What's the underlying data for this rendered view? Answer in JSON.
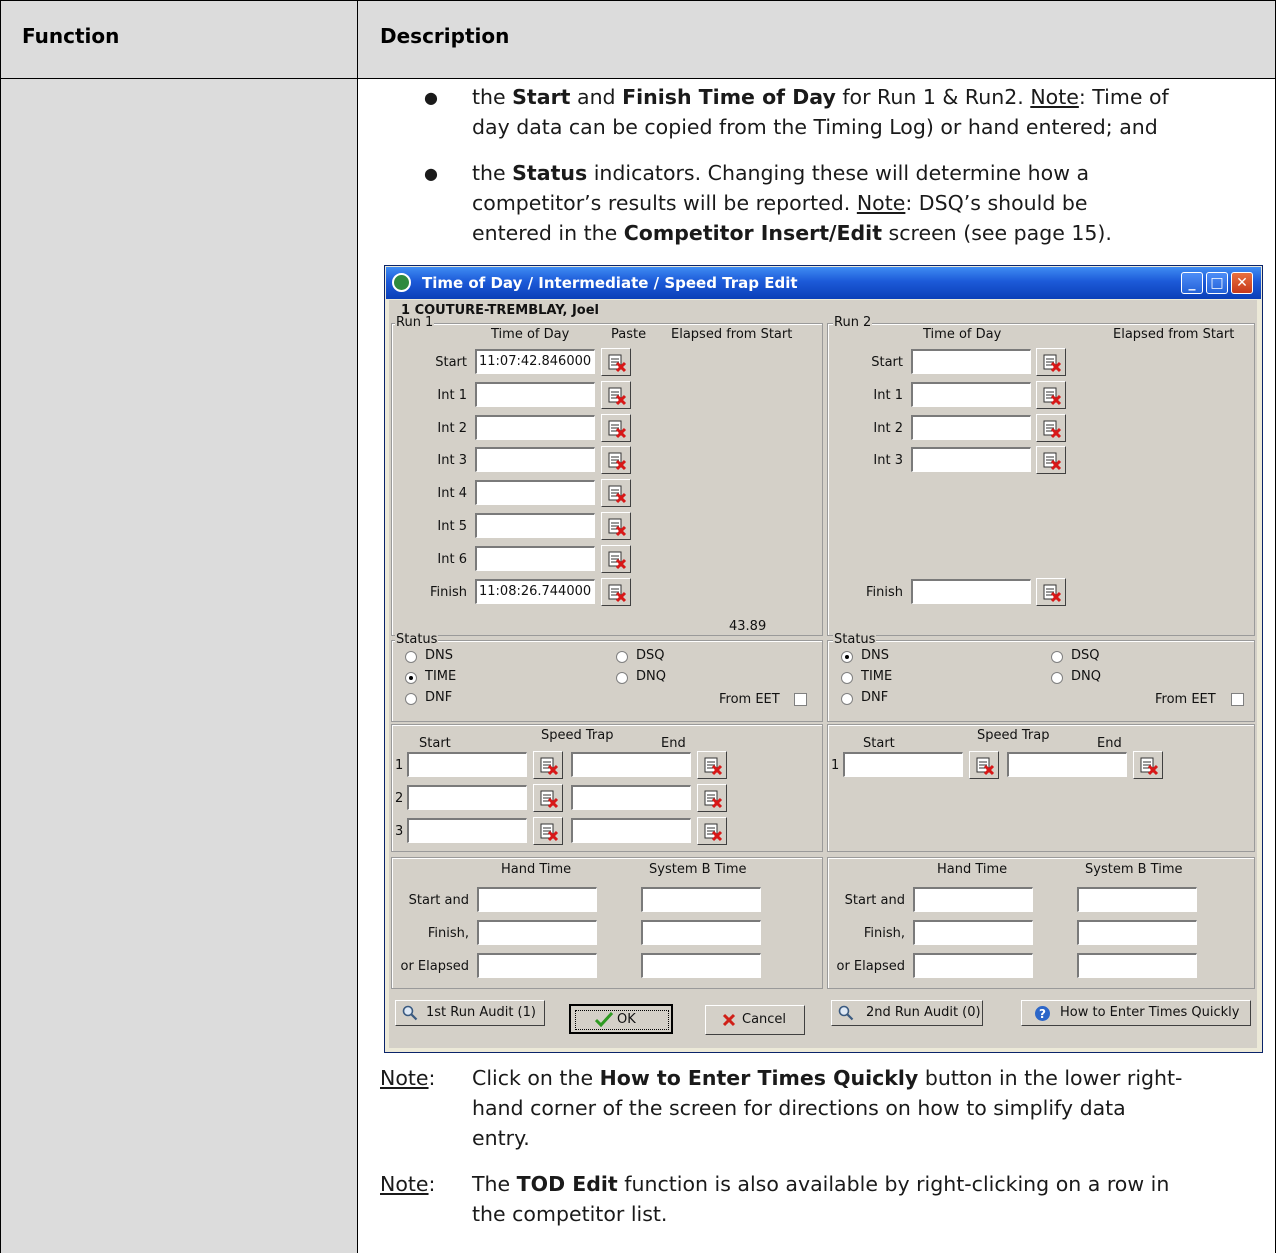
{
  "table": {
    "header_function": "Function",
    "header_description": "Description"
  },
  "bullets": {
    "b1_line1_pre": "the ",
    "b1_start": "Start",
    "b1_and": " and ",
    "b1_finish": "Finish Time of Day",
    "b1_for": " for Run 1 & Run2.  ",
    "b1_note": "Note",
    "b1_tail1": ": Time of",
    "b1_line2": "day data can be copied from the Timing Log) or hand entered; and",
    "b2_pre": "the ",
    "b2_status": "Status",
    "b2_tail1": " indicators. Changing these will determine how a",
    "b2_line2_pre": "competitor’s results will be reported.   ",
    "b2_note": "Note",
    "b2_line2_tail": ": DSQ’s should be",
    "b2_line3_pre": "entered in the ",
    "b2_screen": "Competitor Insert/Edit",
    "b2_line3_tail": " screen (see page 15)."
  },
  "dialog": {
    "title": "Time of Day / Intermediate / Speed Trap Edit",
    "competitor": "1   COUTURE-TREMBLAY, Joel",
    "run1": {
      "label": "Run 1",
      "col_tod": "Time of Day",
      "col_paste": "Paste",
      "col_elapsed": "Elapsed from Start",
      "rows": [
        {
          "label": "Start",
          "value": "11:07:42.846000"
        },
        {
          "label": "Int 1",
          "value": ""
        },
        {
          "label": "Int 2",
          "value": ""
        },
        {
          "label": "Int 3",
          "value": ""
        },
        {
          "label": "Int 4",
          "value": ""
        },
        {
          "label": "Int 5",
          "value": ""
        },
        {
          "label": "Int 6",
          "value": ""
        },
        {
          "label": "Finish",
          "value": "11:08:26.744000"
        }
      ],
      "elapsed": "43.89"
    },
    "run2": {
      "label": "Run 2",
      "col_tod": "Time of Day",
      "col_elapsed": "Elapsed from Start",
      "rows": [
        {
          "label": "Start",
          "value": ""
        },
        {
          "label": "Int 1",
          "value": ""
        },
        {
          "label": "Int 2",
          "value": ""
        },
        {
          "label": "Int 3",
          "value": ""
        },
        {
          "label": "Finish",
          "value": ""
        }
      ]
    },
    "status1": {
      "label": "Status",
      "dns": "DNS",
      "time": "TIME",
      "dnf": "DNF",
      "dsq": "DSQ",
      "dnq": "DNQ",
      "from_eet": "From EET",
      "selected": "TIME"
    },
    "status2": {
      "label": "Status",
      "dns": "DNS",
      "time": "TIME",
      "dnf": "DNF",
      "dsq": "DSQ",
      "dnq": "DNQ",
      "from_eet": "From EET",
      "selected": "DNS"
    },
    "speed1": {
      "start": "Start",
      "title": "Speed Trap",
      "end": "End",
      "rows": [
        "1",
        "2",
        "3"
      ]
    },
    "speed2": {
      "start": "Start",
      "title": "Speed Trap",
      "end": "End",
      "rows": [
        "1"
      ]
    },
    "hand1": {
      "hand": "Hand Time",
      "sysb": "System B Time",
      "start": "Start and",
      "finish": "Finish,",
      "elapsed": "or Elapsed"
    },
    "hand2": {
      "hand": "Hand Time",
      "sysb": "System B Time",
      "start": "Start and",
      "finish": "Finish,",
      "elapsed": "or Elapsed"
    },
    "buttons": {
      "audit1": "1st Run Audit (1)",
      "ok": "OK",
      "cancel": "Cancel",
      "audit2": "2nd Run Audit (0)",
      "howto": "How to Enter Times Quickly"
    },
    "colors": {
      "titlebar": "#0b3fb8",
      "dialog_bg": "#d4d0c8"
    }
  },
  "notes": {
    "n1_label": "Note",
    "n1_colon": ":",
    "n1_line1_pre": "Click on the ",
    "n1_bold": "How to Enter Times Quickly",
    "n1_line1_tail": " button in the lower right-",
    "n1_line2": "hand corner of the screen for directions on how to simplify data",
    "n1_line3": "entry.",
    "n2_label": "Note",
    "n2_colon": ":",
    "n2_line1_pre": "The ",
    "n2_bold": "TOD Edit",
    "n2_line1_tail": " function is also available by right-clicking on a row in",
    "n2_line2": "the competitor list."
  }
}
